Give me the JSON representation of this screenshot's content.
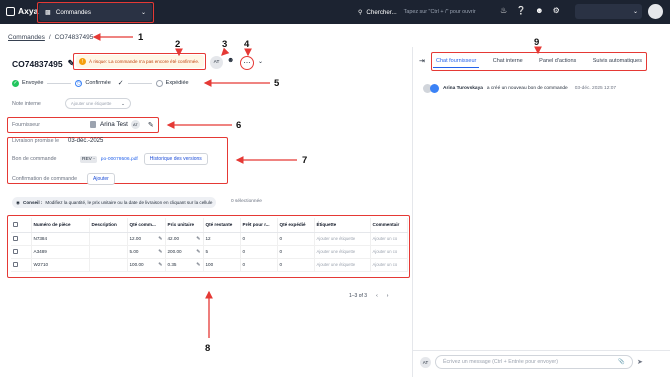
{
  "topbar": {
    "logo": "Axya",
    "module": "Commandes",
    "search_label": "Chercher...",
    "search_placeholder": "Tapez sur \"Ctrl + /\" pour ouvrir",
    "icons": [
      "bell-icon",
      "help-icon",
      "add-user-icon",
      "settings-icon"
    ]
  },
  "breadcrumb": {
    "root": "Commandes",
    "sep": "/",
    "current": "CO74837495"
  },
  "order": {
    "title": "CO74837495",
    "warning": "À risque: La commande n'a pas encore été confirmée.",
    "avatar": "AT"
  },
  "steps": [
    {
      "label": "Envoyée",
      "state": "done"
    },
    {
      "label": "Confirmée",
      "state": "current"
    },
    {
      "label": "Expédiée",
      "state": "todo"
    }
  ],
  "internal_note": {
    "label": "Note interne",
    "placeholder": "Ajouter une étiquette"
  },
  "supplier": {
    "label": "Fournisseur",
    "name": "Arina Test",
    "chip": "AT"
  },
  "details": {
    "promised_label": "Livraison promise le",
    "promised_value": "03-déc.-2025",
    "po_label": "Bon de commande",
    "rev": "REV -",
    "pdf": "po-00079506.pdf",
    "history_button": "Historique des versions",
    "confirm_label": "Confirmation de commande",
    "add_button": "Ajouter"
  },
  "tip": {
    "title": "Conseil :",
    "text": "Modifiez la quantité, le prix unitaire ou la date de livraison en cliquant sur la cellule",
    "selected": "0 sélectionnée"
  },
  "table": {
    "headers": [
      "Numéro de pièce",
      "Description",
      "Qté comm...",
      "Prix unitaire",
      "Qté restante",
      "Prêt pour r...",
      "Qté expédié",
      "Étiquette",
      "Commentair"
    ],
    "rows": [
      {
        "part": "N7384",
        "desc": "",
        "qty": "12.00",
        "price": "42.00",
        "remaining": "12",
        "ready": "0",
        "shipped": "0",
        "tag": "Ajouter une étiquette",
        "comment": "Ajouter un co"
      },
      {
        "part": "A3489",
        "desc": "",
        "qty": "5.00",
        "price": "200.00",
        "remaining": "5",
        "ready": "0",
        "shipped": "0",
        "tag": "Ajouter une étiquette",
        "comment": "Ajouter un co"
      },
      {
        "part": "W2710",
        "desc": "",
        "qty": "100.00",
        "price": "0.35",
        "remaining": "100",
        "ready": "0",
        "shipped": "0",
        "tag": "Ajouter une étiquette",
        "comment": "Ajouter un co"
      }
    ],
    "pager": "1–3 of 3"
  },
  "right_panel": {
    "tabs": [
      "Chat fournisseur",
      "Chat interne",
      "Panel d'actions",
      "Suivis automatiques"
    ],
    "activity": {
      "author": "Arina Turovskaya",
      "text": "a créé un nouveau bon de commande",
      "time": "03-déc. 2025 12:07"
    },
    "compose_avatar": "AT",
    "compose_placeholder": "Écrivez un message (Ctrl + Entrée pour envoyer)"
  },
  "annotations": [
    "1",
    "2",
    "3",
    "4",
    "5",
    "6",
    "7",
    "8",
    "9"
  ],
  "colors": {
    "topbar": "#1c2331",
    "accent": "#2563eb",
    "annotation": "#e53935",
    "success": "#22c55e"
  }
}
